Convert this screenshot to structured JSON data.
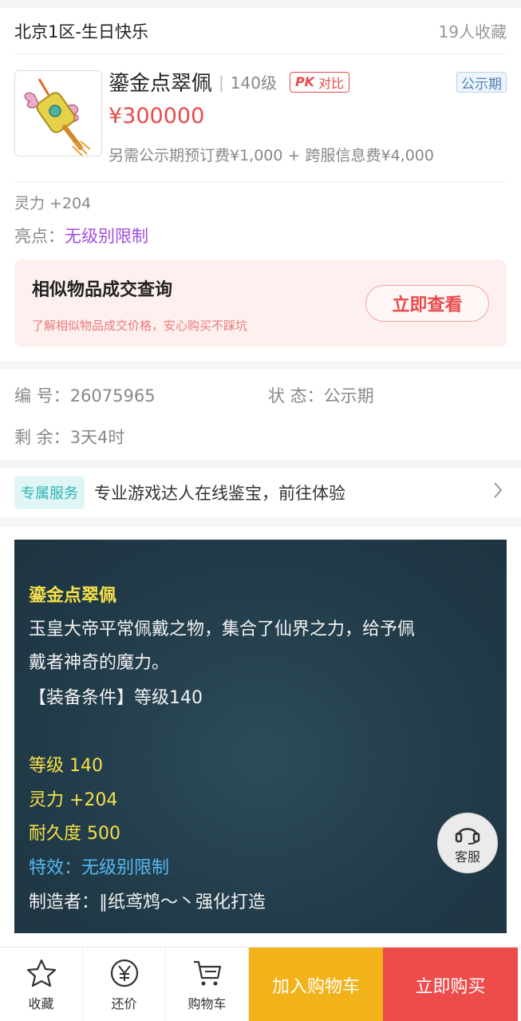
{
  "header": {
    "server": "北京1区-生日快乐",
    "favorites": "19人收藏"
  },
  "item": {
    "name": "鎏金点翠佩",
    "level": "140级",
    "pk_badge": "PK",
    "compare_label": "对比",
    "status": "公示期",
    "price": "¥300000",
    "fee_note": "另需公示期预订费¥1,000 + 跨服信息费¥4,000"
  },
  "attrs": {
    "spirit": "灵力 +204",
    "highlight_label": "亮点：",
    "highlight_value": "无级别限制"
  },
  "similar": {
    "title": "相似物品成交查询",
    "subtitle": "了解相似物品成交价格，安心购买不踩坑",
    "button": "立即查看"
  },
  "info": {
    "id_label": "编  号：",
    "id_value": "26075965",
    "state_label": "状  态：",
    "state_value": "公示期",
    "remain_label": "剩  余：",
    "remain_value": "3天4时"
  },
  "service": {
    "tag": "专属服务",
    "text": "专业游戏达人在线鉴宝，前往体验"
  },
  "description": {
    "name": "鎏金点翠佩",
    "text1": "玉皇大帝平常佩戴之物，集合了仙界之力，给予佩",
    "text2": "戴者神奇的魔力。",
    "condition": "【装备条件】等级140",
    "level": "等级 140",
    "spirit": "灵力 +204",
    "durability": "耐久度 500",
    "effect": "特效：无级别限制",
    "maker": "制造者：∥纸鸢鸩～丶强化打造"
  },
  "customer_service": "客服",
  "bottom": {
    "favorite": "收藏",
    "bargain": "还价",
    "cart": "购物车",
    "add_cart": "加入购物车",
    "buy_now": "立即购买"
  },
  "colors": {
    "price": "#e84a4a",
    "highlight": "#a24ee0",
    "cart_button": "#f2b21a",
    "buy_button": "#ee4b4b"
  }
}
